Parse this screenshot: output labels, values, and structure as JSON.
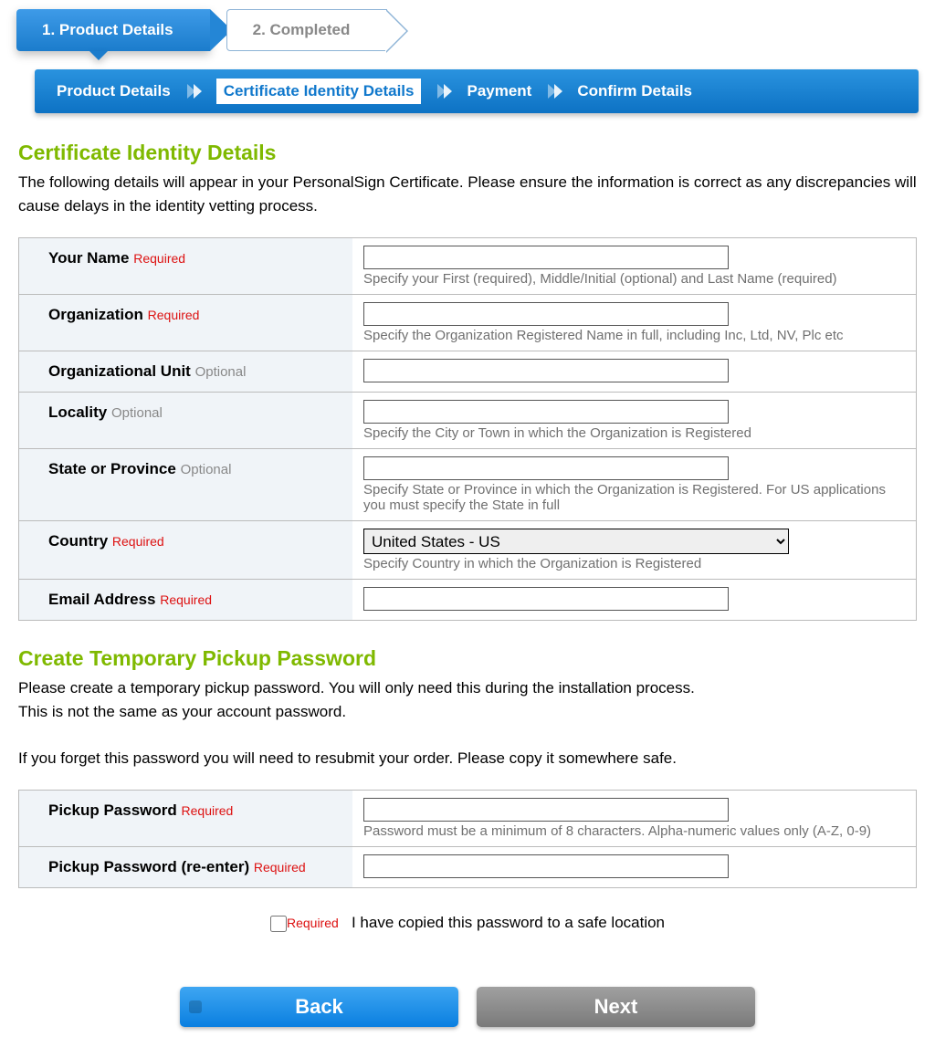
{
  "wizard": {
    "step1": "1. Product Details",
    "step2": "2. Completed"
  },
  "subnav": {
    "item1": "Product Details",
    "item2": "Certificate Identity Details",
    "item3": "Payment",
    "item4": "Confirm Details"
  },
  "section1": {
    "title": "Certificate Identity Details",
    "desc": "The following details will appear in your PersonalSign Certificate. Please ensure the information is correct as any discrepancies will cause delays in the identity vetting process."
  },
  "labels": {
    "required": "Required",
    "optional": "Optional"
  },
  "fields": {
    "name": {
      "label": "Your Name",
      "help": "Specify your First (required), Middle/Initial (optional) and Last Name (required)"
    },
    "org": {
      "label": "Organization",
      "help": "Specify the Organization Registered Name in full, including Inc, Ltd, NV, Plc etc"
    },
    "ou": {
      "label": "Organizational Unit"
    },
    "locality": {
      "label": "Locality",
      "help": "Specify the City or Town in which the Organization is Registered"
    },
    "state": {
      "label": "State or Province",
      "help": "Specify State or Province in which the Organization is Registered. For US applications you must specify the State in full"
    },
    "country": {
      "label": "Country",
      "help": "Specify Country in which the Organization is Registered",
      "selected": "United States - US"
    },
    "email": {
      "label": "Email Address"
    }
  },
  "section2": {
    "title": "Create Temporary Pickup Password",
    "p1": "Please create a temporary pickup password. You will only need this during the installation process.",
    "p2": "This is not the same as your account password.",
    "p3": "If you forget this password you will need to resubmit your order. Please copy it somewhere safe."
  },
  "pw": {
    "label1": "Pickup Password",
    "help1": "Password must be a minimum of 8 characters. Alpha-numeric values only (A-Z, 0-9)",
    "label2": "Pickup Password (re-enter)"
  },
  "confirm": {
    "text": "I have copied this password to a safe location"
  },
  "buttons": {
    "back": "Back",
    "next": "Next"
  }
}
